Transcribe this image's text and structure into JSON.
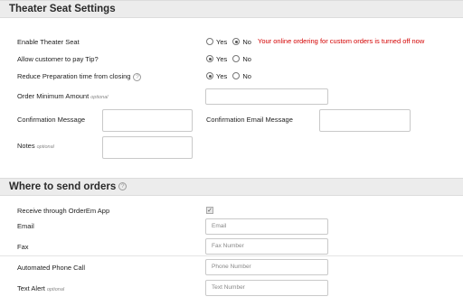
{
  "theater_section": {
    "title": "Theater Seat Settings",
    "enable_label": "Enable Theater Seat",
    "enable_options": [
      "Yes",
      "No"
    ],
    "enable_selected": "No",
    "warning": "Your online ordering for custom orders is turned off now",
    "tip_label": "Allow customer to pay Tip?",
    "tip_options": [
      "Yes",
      "No"
    ],
    "tip_selected": "Yes",
    "reduce_label": "Reduce Preparation time from closing",
    "reduce_options": [
      "Yes",
      "No"
    ],
    "reduce_selected": "Yes",
    "min_amount_label": "Order Minimum Amount",
    "optional_tag": "optional",
    "confirmation_label": "Confirmation Message",
    "confirmation_email_label": "Confirmation Email Message",
    "notes_label": "Notes",
    "help_icon_glyph": "?"
  },
  "orders_section": {
    "title": "Where to send orders",
    "receive_label": "Receive through OrderEm App",
    "receive_checked": true,
    "check_glyph": "✓",
    "email_label": "Email",
    "email_placeholder": "Email",
    "fax_label": "Fax",
    "fax_placeholder": "Fax Number",
    "phone_label": "Automated Phone Call",
    "phone_placeholder": "Phone Number",
    "text_label": "Text Alert",
    "optional_tag": "optional",
    "text_placeholder": "Text Number"
  },
  "colors": {
    "warning": "#d40000",
    "header_bg": "#ececec"
  }
}
